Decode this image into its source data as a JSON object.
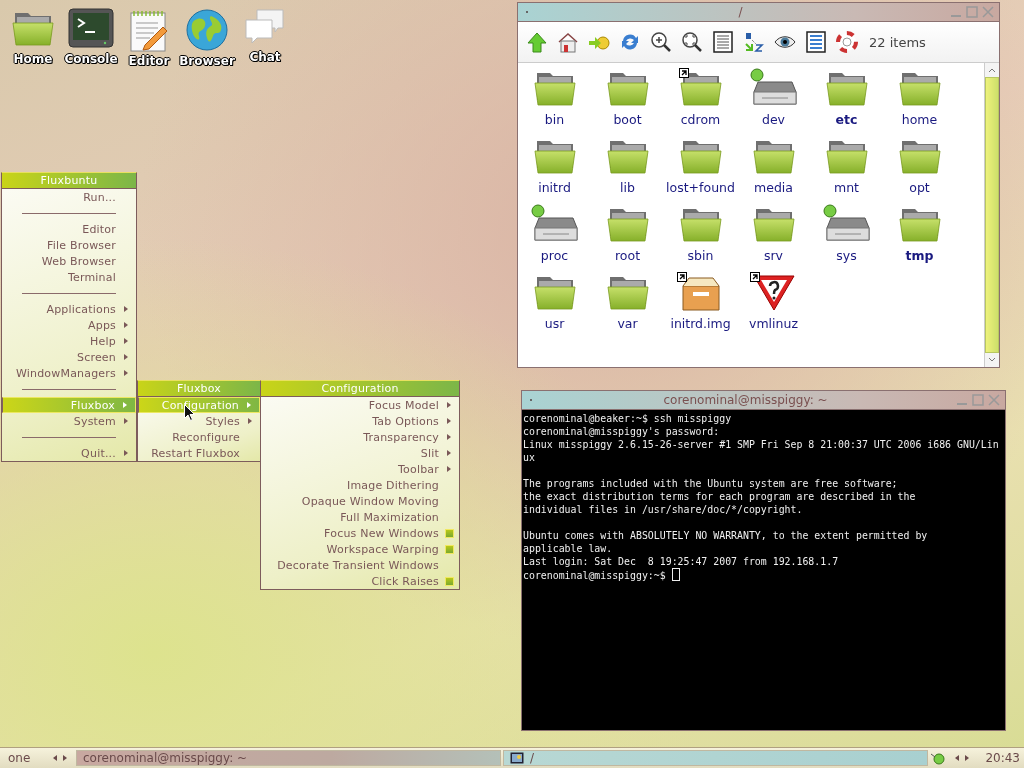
{
  "desktop_icons": [
    {
      "label": "Home",
      "kind": "folder"
    },
    {
      "label": "Console",
      "kind": "terminal"
    },
    {
      "label": "Editor",
      "kind": "notepad"
    },
    {
      "label": "Browser",
      "kind": "globe"
    },
    {
      "label": "Chat",
      "kind": "chat"
    }
  ],
  "root_menu": {
    "title": "Fluxbuntu",
    "items": [
      {
        "kind": "item",
        "label": "Run...",
        "selected": false
      },
      {
        "kind": "separator"
      },
      {
        "kind": "item",
        "label": "Editor",
        "selected": false
      },
      {
        "kind": "item",
        "label": "File Browser",
        "selected": false
      },
      {
        "kind": "item",
        "label": "Web Browser",
        "selected": false
      },
      {
        "kind": "item",
        "label": "Terminal",
        "selected": false
      },
      {
        "kind": "separator"
      },
      {
        "kind": "submenu",
        "label": "Applications",
        "selected": false
      },
      {
        "kind": "submenu",
        "label": "Apps",
        "selected": false
      },
      {
        "kind": "submenu",
        "label": "Help",
        "selected": false
      },
      {
        "kind": "submenu",
        "label": "Screen",
        "selected": false
      },
      {
        "kind": "submenu",
        "label": "WindowManagers",
        "selected": false
      },
      {
        "kind": "separator"
      },
      {
        "kind": "submenu",
        "label": "Fluxbox",
        "selected": true
      },
      {
        "kind": "submenu",
        "label": "System",
        "selected": false
      },
      {
        "kind": "separator"
      },
      {
        "kind": "submenu",
        "label": "Quit...",
        "selected": false
      }
    ]
  },
  "fluxbox_menu": {
    "title": "Fluxbox",
    "items": [
      {
        "kind": "submenu",
        "label": "Configuration",
        "selected": true
      },
      {
        "kind": "submenu",
        "label": "Styles",
        "selected": false
      },
      {
        "kind": "item",
        "label": "Reconfigure",
        "selected": false
      },
      {
        "kind": "item",
        "label": "Restart Fluxbox",
        "selected": false
      }
    ]
  },
  "configuration_menu": {
    "title": "Configuration",
    "items": [
      {
        "kind": "submenu",
        "label": "Focus Model",
        "selected": false
      },
      {
        "kind": "submenu",
        "label": "Tab Options",
        "selected": false
      },
      {
        "kind": "submenu",
        "label": "Transparency",
        "selected": false
      },
      {
        "kind": "submenu",
        "label": "Slit",
        "selected": false
      },
      {
        "kind": "submenu",
        "label": "Toolbar",
        "selected": false
      },
      {
        "kind": "toggle",
        "label": "Image Dithering",
        "checked": false
      },
      {
        "kind": "toggle",
        "label": "Opaque Window Moving",
        "checked": false
      },
      {
        "kind": "toggle",
        "label": "Full Maximization",
        "checked": false
      },
      {
        "kind": "toggle",
        "label": "Focus New Windows",
        "checked": true
      },
      {
        "kind": "toggle",
        "label": "Workspace Warping",
        "checked": true
      },
      {
        "kind": "toggle",
        "label": "Decorate Transient Windows",
        "checked": false
      },
      {
        "kind": "toggle",
        "label": "Click Raises",
        "checked": true
      }
    ]
  },
  "file_manager": {
    "title": "/",
    "item_count": "22 items",
    "files": [
      {
        "name": "bin",
        "kind": "folder",
        "link": false,
        "bold": false
      },
      {
        "name": "boot",
        "kind": "folder",
        "link": false,
        "bold": false
      },
      {
        "name": "cdrom",
        "kind": "folder",
        "link": true,
        "bold": false
      },
      {
        "name": "dev",
        "kind": "drive",
        "link": false,
        "bold": false
      },
      {
        "name": "etc",
        "kind": "folder",
        "link": false,
        "bold": true
      },
      {
        "name": "home",
        "kind": "folder",
        "link": false,
        "bold": false
      },
      {
        "name": "initrd",
        "kind": "folder",
        "link": false,
        "bold": false
      },
      {
        "name": "lib",
        "kind": "folder",
        "link": false,
        "bold": false
      },
      {
        "name": "lost+found",
        "kind": "folder",
        "link": false,
        "bold": false
      },
      {
        "name": "media",
        "kind": "folder",
        "link": false,
        "bold": false
      },
      {
        "name": "mnt",
        "kind": "folder",
        "link": false,
        "bold": false
      },
      {
        "name": "opt",
        "kind": "folder",
        "link": false,
        "bold": false
      },
      {
        "name": "proc",
        "kind": "drive",
        "link": false,
        "bold": false
      },
      {
        "name": "root",
        "kind": "folder",
        "link": false,
        "bold": false
      },
      {
        "name": "sbin",
        "kind": "folder",
        "link": false,
        "bold": false
      },
      {
        "name": "srv",
        "kind": "folder",
        "link": false,
        "bold": false
      },
      {
        "name": "sys",
        "kind": "drive",
        "link": false,
        "bold": false
      },
      {
        "name": "tmp",
        "kind": "folder",
        "link": false,
        "bold": true
      },
      {
        "name": "usr",
        "kind": "folder",
        "link": false,
        "bold": false
      },
      {
        "name": "var",
        "kind": "folder",
        "link": false,
        "bold": false
      },
      {
        "name": "initrd.img",
        "kind": "package",
        "link": true,
        "bold": false
      },
      {
        "name": "vmlinuz",
        "kind": "warning",
        "link": true,
        "bold": false
      }
    ]
  },
  "terminal": {
    "title": "corenominal@misspiggy: ~",
    "output": "corenominal@beaker:~$ ssh misspiggy\ncorenominal@misspiggy's password:\nLinux misspiggy 2.6.15-26-server #1 SMP Fri Sep 8 21:00:37 UTC 2006 i686 GNU/Lin\nux\n\nThe programs included with the Ubuntu system are free software;\nthe exact distribution terms for each program are described in the\nindividual files in /usr/share/doc/*/copyright.\n\nUbuntu comes with ABSOLUTELY NO WARRANTY, to the extent permitted by\napplicable law.\nLast login: Sat Dec  8 19:25:47 2007 from 192.168.1.7\ncorenominal@misspiggy:~$ "
  },
  "taskbar": {
    "workspace": "one",
    "tasks": [
      {
        "label": "corenominal@misspiggy: ~",
        "kind": "terminal",
        "selected": true
      },
      {
        "label": "/",
        "kind": "files",
        "selected": false
      }
    ],
    "clock": "20:43"
  }
}
